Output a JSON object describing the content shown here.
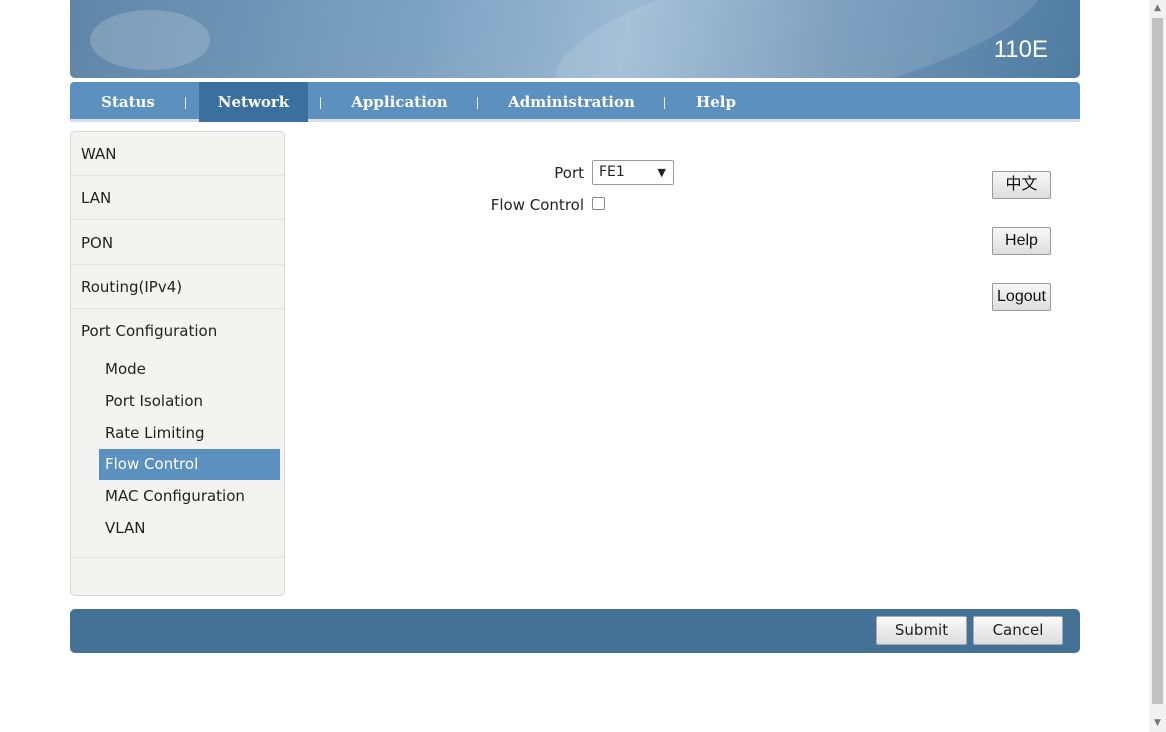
{
  "header": {
    "model": "110E"
  },
  "nav": {
    "tabs": [
      {
        "label": "Status"
      },
      {
        "label": "Network",
        "active": true
      },
      {
        "label": "Application"
      },
      {
        "label": "Administration"
      },
      {
        "label": "Help"
      }
    ]
  },
  "sidebar": {
    "items": [
      "WAN",
      "LAN",
      "PON",
      "Routing(IPv4)",
      "Port Configuration"
    ],
    "subitems": [
      "Mode",
      "Port Isolation",
      "Rate Limiting",
      "Flow Control",
      "MAC Configuration",
      "VLAN"
    ],
    "active_subitem": "Flow Control"
  },
  "form": {
    "port_label": "Port",
    "port_value": "FE1",
    "flow_control_label": "Flow Control",
    "flow_control_checked": false
  },
  "side_buttons": {
    "language": "中文",
    "help": "Help",
    "logout": "Logout"
  },
  "footer": {
    "submit": "Submit",
    "cancel": "Cancel"
  },
  "icons": {
    "select_arrow": "dropdown-arrow-icon",
    "scroll_up": "scroll-up-icon",
    "scroll_down": "scroll-down-icon"
  }
}
